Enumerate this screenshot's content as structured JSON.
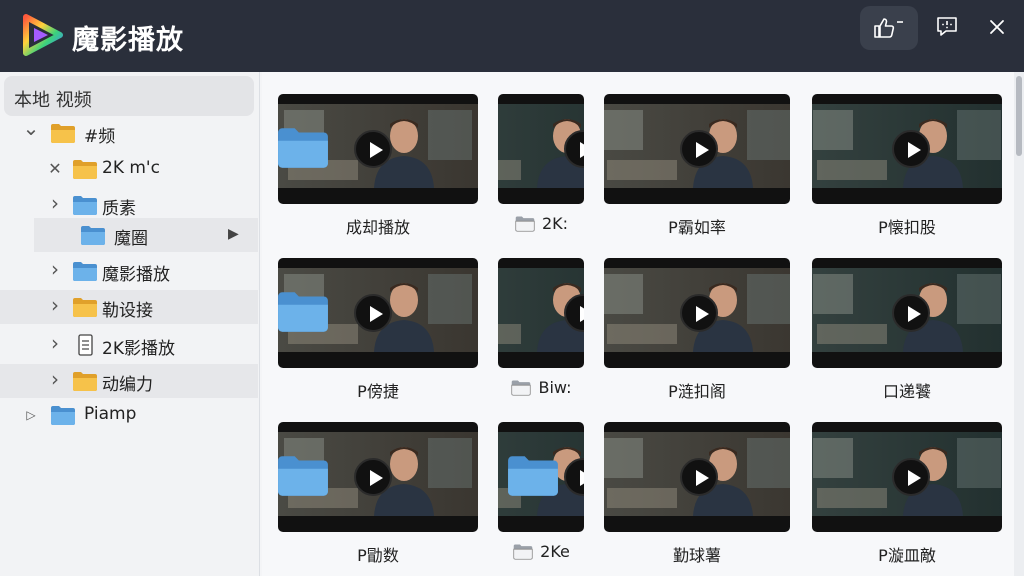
{
  "app": {
    "title": "魔影播放",
    "colors": {
      "titlebar": "#2a2f3b",
      "folder": "#f3b73c",
      "folder_blue": "#5aa3de"
    }
  },
  "sidebar": {
    "header": "本地 视频",
    "items": [
      {
        "label": "#频",
        "toggle": "chevron-down",
        "icon": "folder-yellow",
        "level": 1
      },
      {
        "label": "2K m'c",
        "toggle": "close",
        "icon": "folder-yellow",
        "level": 2
      },
      {
        "label": "质素",
        "toggle": "chevron-right",
        "icon": "folder-blue",
        "level": 2
      },
      {
        "label": "魔圈",
        "toggle": "",
        "icon": "folder-blue",
        "level": 3,
        "selected": true
      },
      {
        "label": "魔影播放",
        "toggle": "chevron-right",
        "icon": "folder-blue",
        "level": 2
      },
      {
        "label": "勒设接",
        "toggle": "chevron-right",
        "icon": "folder-yellow",
        "level": 2
      },
      {
        "label": "2K影播放",
        "toggle": "chevron-right",
        "icon": "file",
        "level": 2
      },
      {
        "label": "动编力",
        "toggle": "chevron-right",
        "icon": "folder-yellow",
        "level": 2
      },
      {
        "label": "Piamp",
        "toggle": "triangle-right",
        "icon": "folder-blue",
        "level": 1
      }
    ]
  },
  "grid": {
    "tiles": [
      {
        "caption": "成却播放",
        "folder_overlay": true,
        "caption_icon": ""
      },
      {
        "caption": "2K:",
        "folder_overlay": false,
        "caption_icon": "folder-icon"
      },
      {
        "caption": "P霸如率",
        "folder_overlay": false,
        "caption_icon": ""
      },
      {
        "caption": "P懐扣股",
        "folder_overlay": false,
        "caption_icon": ""
      },
      {
        "caption": "P傍捷",
        "folder_overlay": true,
        "caption_icon": ""
      },
      {
        "caption": "Biw:",
        "folder_overlay": false,
        "caption_icon": "folder-icon"
      },
      {
        "caption": "P涟扣阁",
        "folder_overlay": false,
        "caption_icon": ""
      },
      {
        "caption": "口递饕",
        "folder_overlay": false,
        "caption_icon": ""
      },
      {
        "caption": "P勖数",
        "folder_overlay": true,
        "caption_icon": ""
      },
      {
        "caption": "2Ke",
        "folder_overlay": true,
        "caption_icon": "folder-icon"
      },
      {
        "caption": "勤球薯",
        "folder_overlay": false,
        "caption_icon": ""
      },
      {
        "caption": "P漩皿敵",
        "folder_overlay": false,
        "caption_icon": ""
      }
    ]
  }
}
